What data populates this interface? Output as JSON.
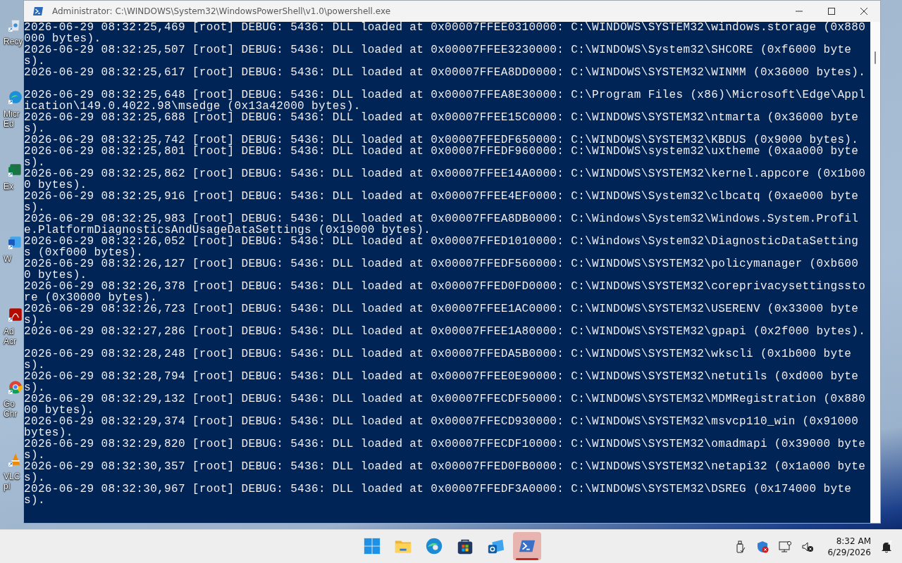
{
  "desktop_icons": [
    {
      "kind": "bin",
      "label": [
        "Recy"
      ]
    },
    {
      "kind": "edge",
      "label": [
        "Micr",
        "Ed"
      ]
    },
    {
      "kind": "excel",
      "label": [
        "Ex"
      ]
    },
    {
      "kind": "word",
      "label": [
        "W"
      ]
    },
    {
      "kind": "acrobat",
      "label": [
        "Ad",
        "Acr"
      ]
    },
    {
      "kind": "chrome",
      "label": [
        "Go",
        "Chr"
      ]
    },
    {
      "kind": "vlc",
      "label": [
        "VLC",
        "pl"
      ]
    }
  ],
  "window": {
    "title": "Administrator: C:\\WINDOWS\\System32\\WindowsPowerShell\\v1.0\\powershell.exe"
  },
  "console_lines": [
    "2026-06-29 08:32:25,469 [root] DEBUG: 5436: DLL loaded at 0x00007FFEE0310000: C:\\WINDOWS\\SYSTEM32\\windows.storage (0x880000 bytes).",
    "2026-06-29 08:32:25,507 [root] DEBUG: 5436: DLL loaded at 0x00007FFEE3230000: C:\\WINDOWS\\System32\\SHCORE (0xf6000 bytes).",
    "2026-06-29 08:32:25,617 [root] DEBUG: 5436: DLL loaded at 0x00007FFEA8DD0000: C:\\WINDOWS\\SYSTEM32\\WINMM (0x36000 bytes).",
    "2026-06-29 08:32:25,648 [root] DEBUG: 5436: DLL loaded at 0x00007FFEA8E30000: C:\\Program Files (x86)\\Microsoft\\Edge\\Application\\149.0.4022.98\\msedge (0x13a42000 bytes).",
    "2026-06-29 08:32:25,688 [root] DEBUG: 5436: DLL loaded at 0x00007FFEE15C0000: C:\\WINDOWS\\SYSTEM32\\ntmarta (0x36000 bytes).",
    "2026-06-29 08:32:25,742 [root] DEBUG: 5436: DLL loaded at 0x00007FFEDF650000: C:\\WINDOWS\\SYSTEM32\\KBDUS (0x9000 bytes).",
    "2026-06-29 08:32:25,801 [root] DEBUG: 5436: DLL loaded at 0x00007FFEDF960000: C:\\WINDOWS\\system32\\uxtheme (0xaa000 bytes).",
    "2026-06-29 08:32:25,862 [root] DEBUG: 5436: DLL loaded at 0x00007FFEE14A0000: C:\\WINDOWS\\SYSTEM32\\kernel.appcore (0x1b000 bytes).",
    "2026-06-29 08:32:25,916 [root] DEBUG: 5436: DLL loaded at 0x00007FFEE4EF0000: C:\\WINDOWS\\System32\\clbcatq (0xae000 bytes).",
    "2026-06-29 08:32:25,983 [root] DEBUG: 5436: DLL loaded at 0x00007FFEA8DB0000: C:\\Windows\\System32\\Windows.System.Profile.PlatformDiagnosticsAndUsageDataSettings (0x19000 bytes).",
    "2026-06-29 08:32:26,052 [root] DEBUG: 5436: DLL loaded at 0x00007FFED1010000: C:\\Windows\\System32\\DiagnosticDataSettings (0xf000 bytes).",
    "2026-06-29 08:32:26,127 [root] DEBUG: 5436: DLL loaded at 0x00007FFEDF560000: C:\\WINDOWS\\SYSTEM32\\policymanager (0xb6000 bytes).",
    "2026-06-29 08:32:26,378 [root] DEBUG: 5436: DLL loaded at 0x00007FFED0FD0000: C:\\WINDOWS\\SYSTEM32\\coreprivacysettingsstore (0x30000 bytes).",
    "2026-06-29 08:32:26,723 [root] DEBUG: 5436: DLL loaded at 0x00007FFEE1AC0000: C:\\WINDOWS\\SYSTEM32\\USERENV (0x33000 bytes).",
    "2026-06-29 08:32:27,286 [root] DEBUG: 5436: DLL loaded at 0x00007FFEE1A80000: C:\\WINDOWS\\SYSTEM32\\gpapi (0x2f000 bytes).",
    "2026-06-29 08:32:28,248 [root] DEBUG: 5436: DLL loaded at 0x00007FFEDA5B0000: C:\\WINDOWS\\SYSTEM32\\wkscli (0x1b000 bytes).",
    "2026-06-29 08:32:28,794 [root] DEBUG: 5436: DLL loaded at 0x00007FFEE0E90000: C:\\WINDOWS\\SYSTEM32\\netutils (0xd000 bytes).",
    "2026-06-29 08:32:29,132 [root] DEBUG: 5436: DLL loaded at 0x00007FFECDF50000: C:\\WINDOWS\\SYSTEM32\\MDMRegistration (0x88000 bytes).",
    "2026-06-29 08:32:29,374 [root] DEBUG: 5436: DLL loaded at 0x00007FFECD930000: C:\\WINDOWS\\SYSTEM32\\msvcp110_win (0x91000 bytes).",
    "2026-06-29 08:32:29,820 [root] DEBUG: 5436: DLL loaded at 0x00007FFECDF10000: C:\\WINDOWS\\SYSTEM32\\omadmapi (0x39000 bytes).",
    "2026-06-29 08:32:30,357 [root] DEBUG: 5436: DLL loaded at 0x00007FFED0FB0000: C:\\WINDOWS\\SYSTEM32\\netapi32 (0x1a000 bytes).",
    "2026-06-29 08:32:30,967 [root] DEBUG: 5436: DLL loaded at 0x00007FFEDF3A0000: C:\\WINDOWS\\SYSTEM32\\DSREG (0x174000 bytes)."
  ],
  "taskbar": {
    "apps": [
      {
        "kind": "start",
        "selected": false
      },
      {
        "kind": "explorer",
        "selected": false
      },
      {
        "kind": "edge",
        "selected": false
      },
      {
        "kind": "store",
        "selected": false
      },
      {
        "kind": "outlook",
        "selected": false
      },
      {
        "kind": "powershell",
        "selected": true
      }
    ],
    "time": "8:32 AM",
    "date": "6/29/2026"
  }
}
